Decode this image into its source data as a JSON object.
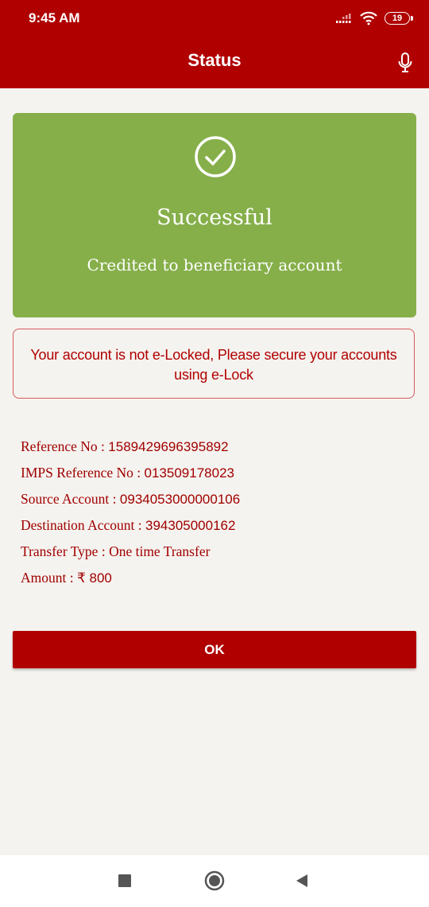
{
  "status_bar": {
    "time": "9:45 AM",
    "battery": "19"
  },
  "header": {
    "title": "Status"
  },
  "success": {
    "title": "Successful",
    "subtitle": "Credited to beneficiary account"
  },
  "warning": {
    "line1": "Your account is not e-Locked, Please secure your accounts",
    "line2": "using e-Lock"
  },
  "details": [
    {
      "label": "Reference No : ",
      "value": "1589429696395892"
    },
    {
      "label": "IMPS Reference No : ",
      "value": "013509178023"
    },
    {
      "label": "Source Account : ",
      "value": "0934053000000106"
    },
    {
      "label": "Destination Account : ",
      "value": "394305000162"
    },
    {
      "label": "Transfer Type : ",
      "value": "One time Transfer"
    },
    {
      "label": "Amount : ",
      "value": "₹ 800"
    }
  ],
  "ok_button": {
    "label": "OK"
  },
  "colors": {
    "brand_red": "#b00000",
    "success_green": "#86af4a",
    "background": "#f5f3ef"
  },
  "icons": [
    "signal-icon",
    "wifi-icon",
    "battery-icon",
    "mic-icon",
    "check-circle-icon",
    "recents-icon",
    "home-icon",
    "back-icon"
  ]
}
